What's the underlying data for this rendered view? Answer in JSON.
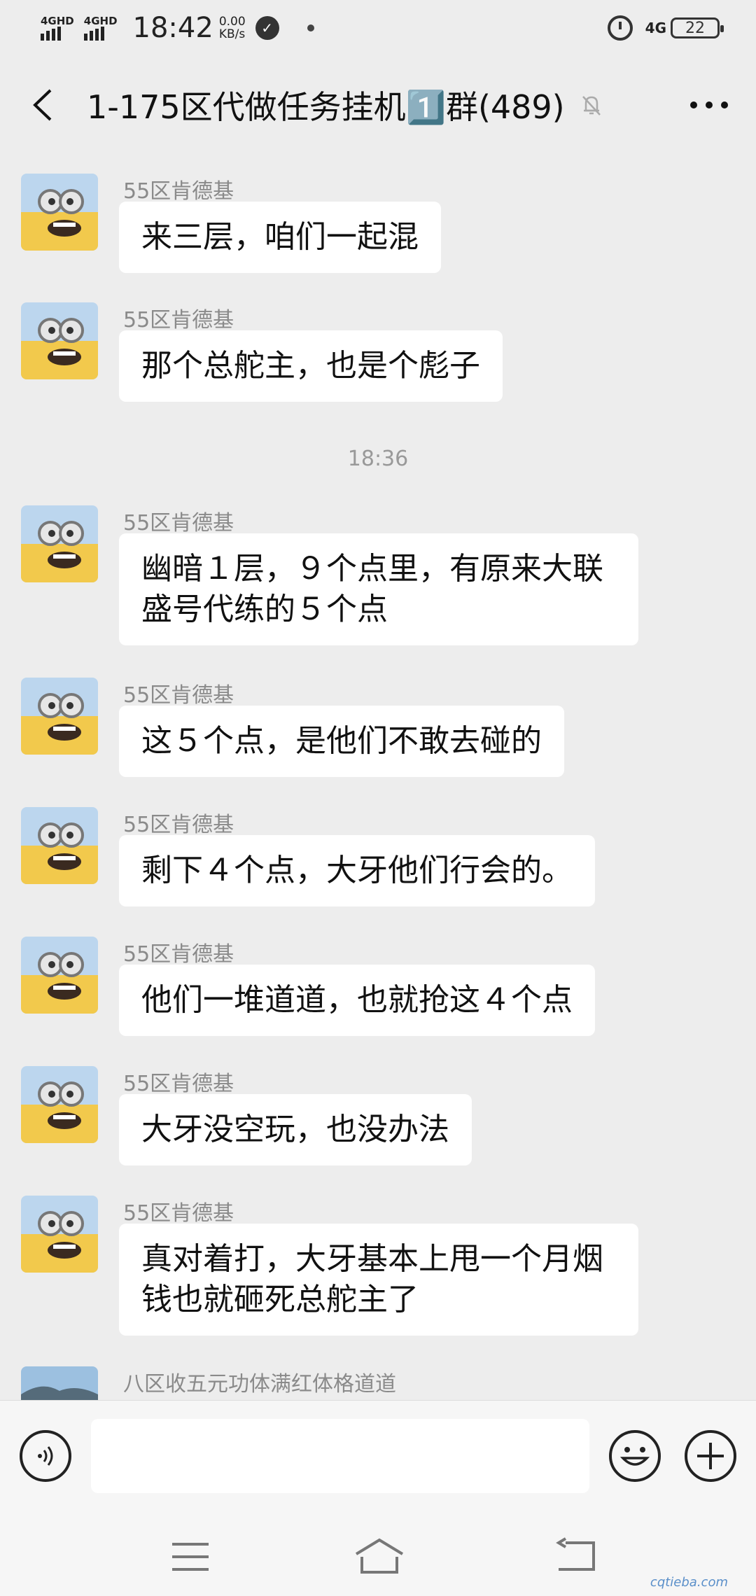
{
  "status_bar": {
    "sim1": "4GHD",
    "sim2": "4GHD",
    "time": "18:42",
    "speed_value": "0.00",
    "speed_unit": "KB/s",
    "network": "4G",
    "battery": "22"
  },
  "header": {
    "title": "1-175区代做任务挂机1️⃣群(489)"
  },
  "messages": [
    {
      "sender": "55区肯德基",
      "text": "来三层，咱们一起混"
    },
    {
      "sender": "55区肯德基",
      "text": "那个总舵主，也是个彪子"
    },
    {
      "sender": "55区肯德基",
      "text": "幽暗１层，９个点里，有原来大联盛号代练的５个点"
    },
    {
      "sender": "55区肯德基",
      "text": "这５个点，是他们不敢去碰的"
    },
    {
      "sender": "55区肯德基",
      "text": "剩下４个点，大牙他们行会的。"
    },
    {
      "sender": "55区肯德基",
      "text": "他们一堆道道，也就抢这４个点"
    },
    {
      "sender": "55区肯德基",
      "text": "大牙没空玩，也没办法"
    },
    {
      "sender": "55区肯德基",
      "text": "真对着打，大牙基本上甩一个月烟钱也就砸死总舵主了"
    },
    {
      "sender": "八区收五元功体满红体格道道",
      "text": ""
    }
  ],
  "timestamp": "18:36",
  "watermark": "cqtieba.com"
}
